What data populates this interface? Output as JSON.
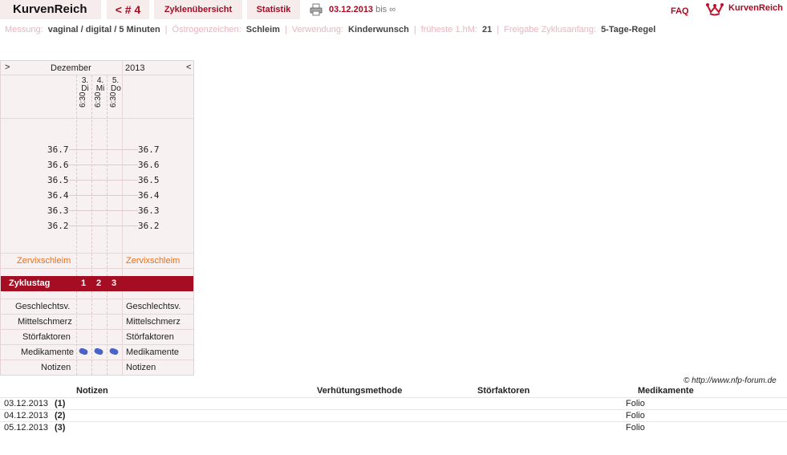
{
  "header": {
    "brand": "KurvenReich",
    "cycle": "< # 4",
    "tab_overview": "Zyklenübersicht",
    "tab_stats": "Statistik",
    "date_from": "03.12.2013",
    "date_bis": "bis",
    "date_to": "∞",
    "faq": "FAQ",
    "logo_text": "KurvenReich"
  },
  "info": [
    {
      "label": "Messung:",
      "value": "vaginal / digital / 5 Minuten"
    },
    {
      "label": "Östrogenzeichen:",
      "value": "Schleim"
    },
    {
      "label": "Verwendung:",
      "value": "Kinderwunsch"
    },
    {
      "label": "früheste 1.hM:",
      "value": "21"
    },
    {
      "label": "Freigabe Zyklusanfang:",
      "value": "5-Tage-Regel"
    }
  ],
  "chart": {
    "nav_prev": ">",
    "nav_next": "<",
    "month": "Dezember",
    "year": "2013",
    "days": [
      {
        "num": "3.",
        "dow": "Di",
        "time": "6:30"
      },
      {
        "num": "4.",
        "dow": "Mi",
        "time": "6:30"
      },
      {
        "num": "5.",
        "dow": "Do",
        "time": "6:30"
      }
    ],
    "temps": [
      "36.7",
      "36.6",
      "36.5",
      "36.4",
      "36.3",
      "36.2"
    ],
    "cervix_label": "Zervixschleim",
    "cycle_day_label": "Zyklustag",
    "cycle_days": [
      "1",
      "2",
      "3"
    ],
    "rows": [
      "Geschlechtsv.",
      "Mittelschmerz",
      "Störfaktoren",
      "Medikamente",
      "Notizen"
    ],
    "medication_icon": "pill-icon"
  },
  "copyright": "© http://www.nfp-forum.de",
  "table": {
    "headers": [
      "Notizen",
      "Verhütungsmethode",
      "Störfaktoren",
      "Medikamente"
    ],
    "rows": [
      {
        "date": "03.12.2013",
        "idx": "(1)",
        "med": "Folio"
      },
      {
        "date": "04.12.2013",
        "idx": "(2)",
        "med": "Folio"
      },
      {
        "date": "05.12.2013",
        "idx": "(3)",
        "med": "Folio"
      }
    ]
  }
}
